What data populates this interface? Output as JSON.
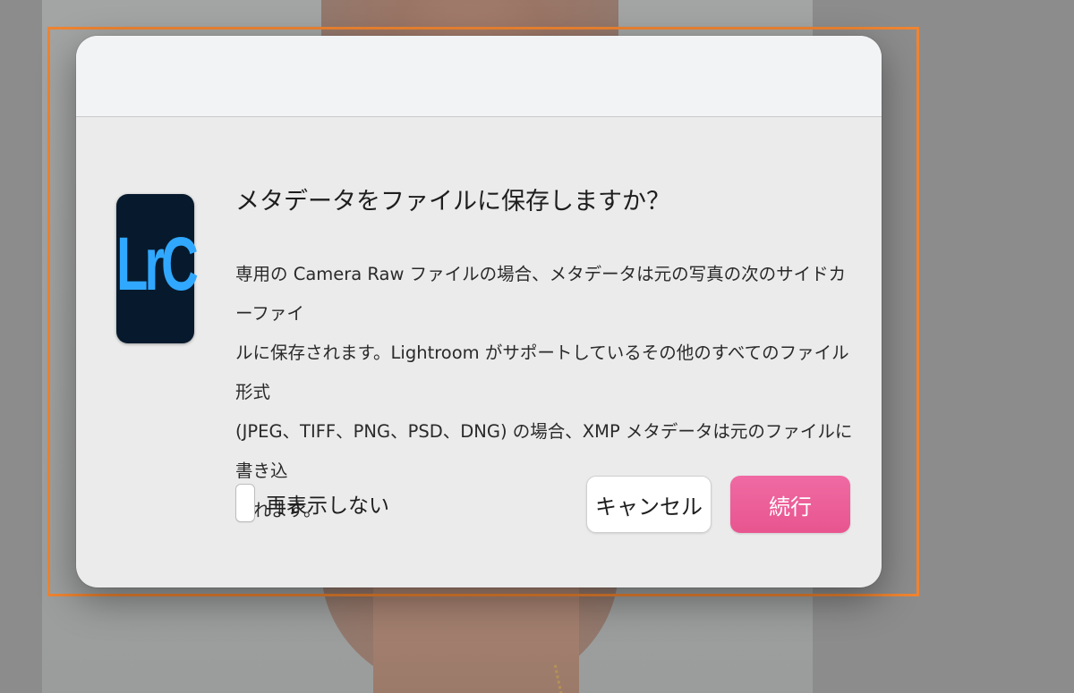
{
  "dialog": {
    "app_icon_text": "LrC",
    "title": "メタデータをファイルに保存しますか？",
    "message_lines": [
      "専用の Camera Raw ファイルの場合、メタデータは元の写真の次のサイドカーファイ",
      "ルに保存されます。Lightroom がサポートしているその他のすべてのファイル形式",
      "(JPEG、TIFF、PNG、PSD、DNG) の場合、XMP メタデータは元のファイルに書き込",
      "まれます。"
    ],
    "checkbox": {
      "label": "再表示しない",
      "checked": false
    },
    "buttons": {
      "cancel_label": "キャンセル",
      "continue_label": "続行"
    }
  },
  "colors": {
    "selection_frame": "#ef8431",
    "continue_button": "#ea5b96",
    "app_icon_bg": "#071a2d",
    "app_icon_fg": "#31a8ff"
  }
}
